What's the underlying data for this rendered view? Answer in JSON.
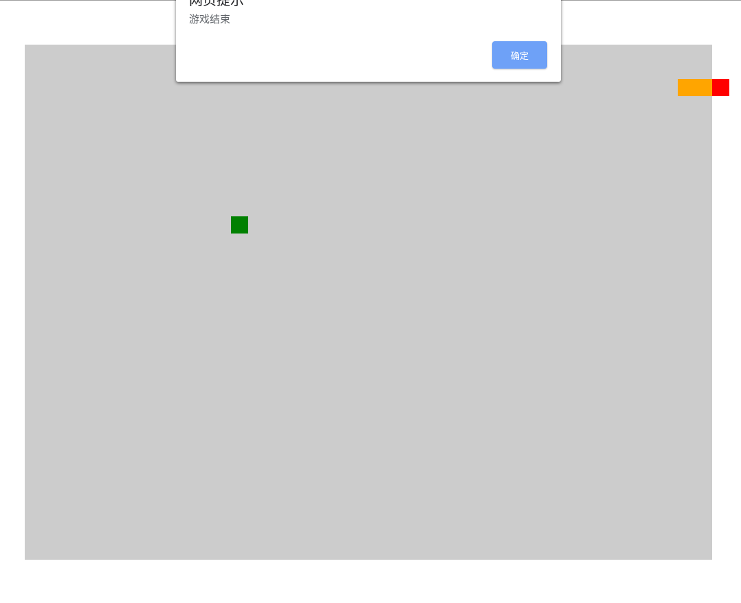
{
  "dialog": {
    "title": "网页提示",
    "message": "游戏结束",
    "ok_label": "确定"
  },
  "colors": {
    "board": "#cccccc",
    "snake_body": "#ffa500",
    "snake_head": "#ff0000",
    "food": "#008000",
    "ok_button": "#6ea1f7"
  },
  "game": {
    "state": "game-over"
  }
}
